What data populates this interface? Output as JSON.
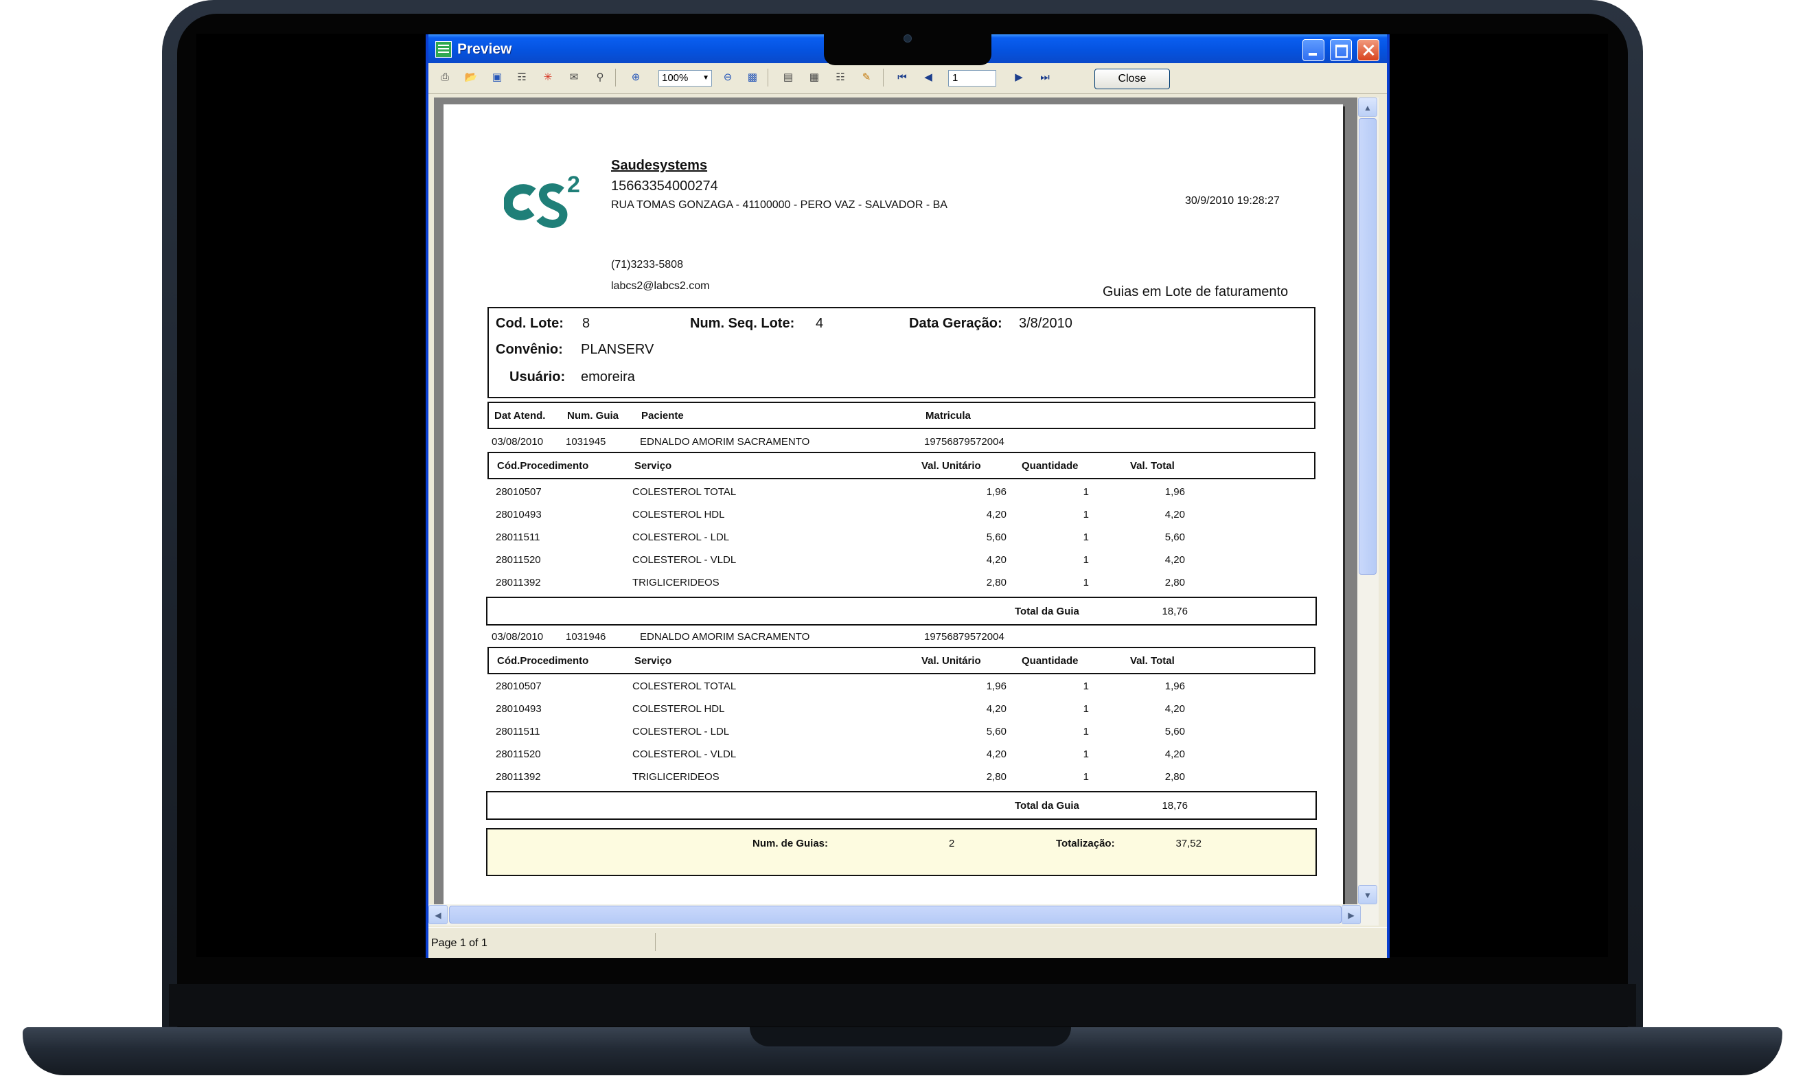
{
  "window": {
    "title": "Preview",
    "close_label": "Close",
    "zoom": "100%",
    "page_input": "1",
    "status": "Page 1 of 1"
  },
  "toolbar_icons": [
    "print-icon",
    "open-icon",
    "save-icon",
    "export-icon",
    "pdf-icon",
    "email-icon",
    "find-icon",
    "zoom-in-icon",
    "zoom-out-icon",
    "fit-page-icon",
    "single-page-icon",
    "multi-page-icon",
    "book-icon",
    "edit-icon",
    "first-page-icon",
    "prev-page-icon",
    "next-page-icon",
    "last-page-icon"
  ],
  "report": {
    "company": "Saudesystems",
    "cnpj": "15663354000274",
    "address": "RUA TOMAS GONZAGA -  41100000 - PERO VAZ - SALVADOR - BA",
    "timestamp": "30/9/2010 19:28:27",
    "phone": "(71)3233-5808",
    "email": "labcs2@labcs2.com",
    "report_title": "Guias em Lote de faturamento",
    "cod_lote_label": "Cod. Lote:",
    "cod_lote": "8",
    "num_seq_label": "Num. Seq. Lote:",
    "num_seq": "4",
    "data_geracao_label": "Data Geração:",
    "data_geracao": "3/8/2010",
    "convenio_label": "Convênio:",
    "convenio": "PLANSERV",
    "usuario_label": "Usuário:",
    "usuario": "emoreira",
    "guia_headers": [
      "Dat Atend.",
      "Num. Guia",
      "Paciente",
      "Matricula"
    ],
    "item_headers": [
      "Cód.Procedimento",
      "Serviço",
      "Val. Unitário",
      "Quantidade",
      "Val. Total"
    ],
    "total_guia_label": "Total da Guia",
    "guias": [
      {
        "date": "03/08/2010",
        "num": "1031945",
        "patient": "EDNALDO AMORIM SACRAMENTO",
        "matricula": "19756879572004",
        "items": [
          {
            "code": "28010507",
            "service": "COLESTEROL TOTAL",
            "unit": "1,96",
            "qty": "1",
            "total": "1,96"
          },
          {
            "code": "28010493",
            "service": "COLESTEROL HDL",
            "unit": "4,20",
            "qty": "1",
            "total": "4,20"
          },
          {
            "code": "28011511",
            "service": "COLESTEROL - LDL",
            "unit": "5,60",
            "qty": "1",
            "total": "5,60"
          },
          {
            "code": "28011520",
            "service": "COLESTEROL - VLDL",
            "unit": "4,20",
            "qty": "1",
            "total": "4,20"
          },
          {
            "code": "28011392",
            "service": "TRIGLICERIDEOS",
            "unit": "2,80",
            "qty": "1",
            "total": "2,80"
          }
        ],
        "total": "18,76"
      },
      {
        "date": "03/08/2010",
        "num": "1031946",
        "patient": "EDNALDO AMORIM SACRAMENTO",
        "matricula": "19756879572004",
        "items": [
          {
            "code": "28010507",
            "service": "COLESTEROL TOTAL",
            "unit": "1,96",
            "qty": "1",
            "total": "1,96"
          },
          {
            "code": "28010493",
            "service": "COLESTEROL HDL",
            "unit": "4,20",
            "qty": "1",
            "total": "4,20"
          },
          {
            "code": "28011511",
            "service": "COLESTEROL - LDL",
            "unit": "5,60",
            "qty": "1",
            "total": "5,60"
          },
          {
            "code": "28011520",
            "service": "COLESTEROL - VLDL",
            "unit": "4,20",
            "qty": "1",
            "total": "4,20"
          },
          {
            "code": "28011392",
            "service": "TRIGLICERIDEOS",
            "unit": "2,80",
            "qty": "1",
            "total": "2,80"
          }
        ],
        "total": "18,76"
      }
    ],
    "num_guias_label": "Num. de Guias:",
    "num_guias": "2",
    "totalizacao_label": "Totalização:",
    "totalizacao": "37,52"
  },
  "colors": {
    "titlebar": "#0553e0",
    "logo": "#1f7f78",
    "summary_bg": "#fdfbe0"
  }
}
